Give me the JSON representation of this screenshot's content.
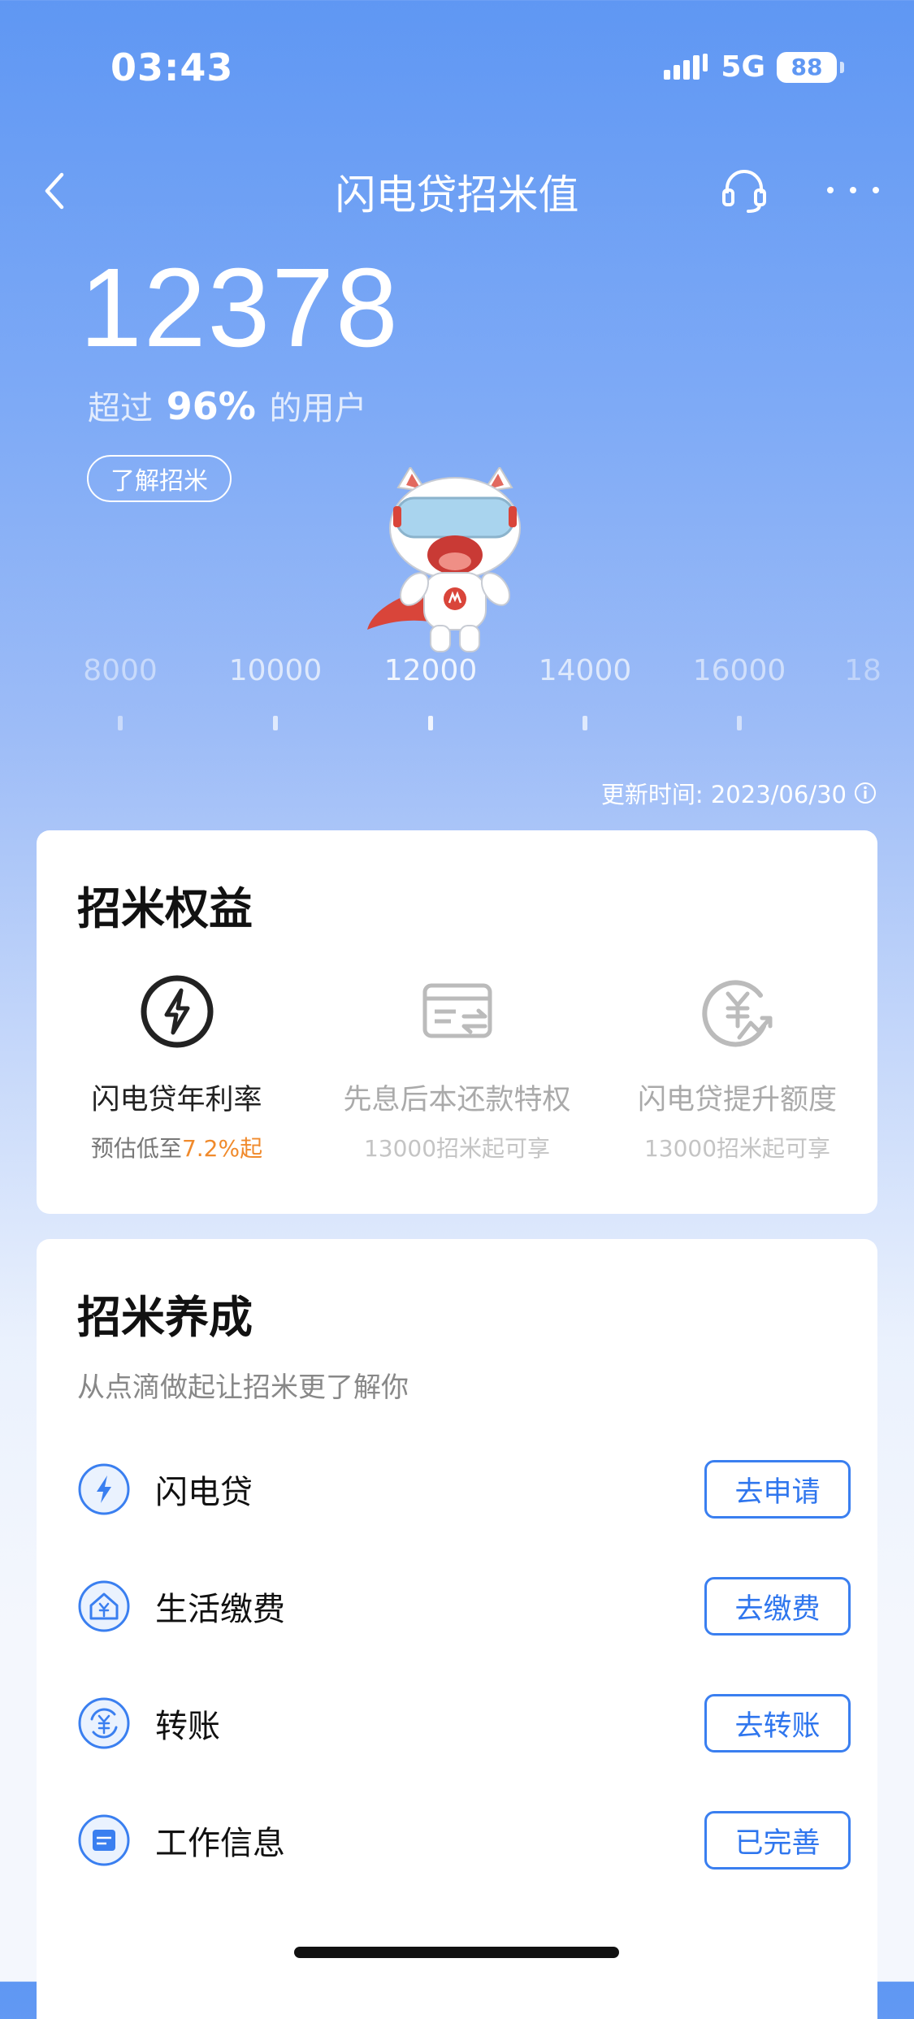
{
  "status_bar": {
    "time": "03:43",
    "network": "5G",
    "battery": "88"
  },
  "nav": {
    "title": "闪电贷招米值"
  },
  "score": {
    "value": "12378",
    "exceed_prefix": "超过",
    "exceed_percent": "96%",
    "exceed_suffix": "的用户",
    "learn_button": "了解招米"
  },
  "scale": {
    "labels": [
      "8000",
      "10000",
      "12000",
      "14000",
      "16000",
      "18"
    ]
  },
  "update": {
    "text": "更新时间: 2023/06/30"
  },
  "benefits": {
    "title": "招米权益",
    "items": [
      {
        "icon": "lightning-circle-icon",
        "name": "闪电贷年利率",
        "sub_prefix": "预估低至",
        "sub_highlight": "7.2%起"
      },
      {
        "icon": "card-exchange-icon",
        "name": "先息后本还款特权",
        "sub": "13000招米起可享"
      },
      {
        "icon": "yuan-upgrade-icon",
        "name": "闪电贷提升额度",
        "sub": "13000招米起可享"
      }
    ]
  },
  "nurture": {
    "title": "招米养成",
    "subtitle": "从点滴做起让招米更了解你",
    "tasks": [
      {
        "icon": "lightning-icon",
        "label": "闪电贷",
        "button": "去申请"
      },
      {
        "icon": "house-yuan-icon",
        "label": "生活缴费",
        "button": "去缴费"
      },
      {
        "icon": "transfer-yuan-icon",
        "label": "转账",
        "button": "去转账"
      },
      {
        "icon": "document-icon",
        "label": "工作信息",
        "button": "已完善"
      }
    ]
  },
  "colors": {
    "accent": "#3a7ff0",
    "highlight": "#f08a2c",
    "header_blue": "#5f97f3"
  }
}
